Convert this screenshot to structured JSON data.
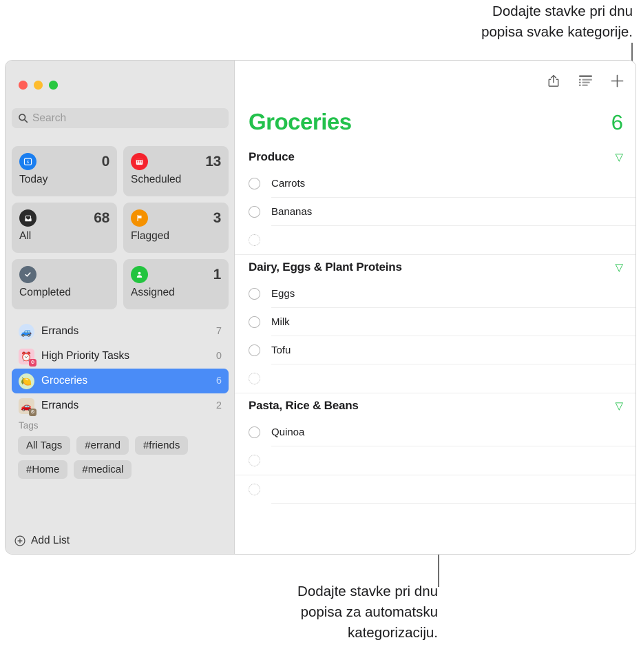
{
  "callouts": {
    "top": "Dodajte stavke pri dnu\npopisa svake kategorije.",
    "bottom": "Dodajte stavke pri dnu\npopisa za automatsku\nkategorizaciju."
  },
  "window": {
    "traffic_lights": [
      "close",
      "minimize",
      "zoom"
    ]
  },
  "sidebar": {
    "search": {
      "placeholder": "Search",
      "value": ""
    },
    "smart_lists": [
      {
        "label": "Today",
        "count": "0",
        "icon": "calendar-day-icon",
        "color": "#1a7ef0"
      },
      {
        "label": "Scheduled",
        "count": "13",
        "icon": "calendar-icon",
        "color": "#f5222d"
      },
      {
        "label": "All",
        "count": "68",
        "icon": "inbox-icon",
        "color": "#2b2b2b"
      },
      {
        "label": "Flagged",
        "count": "3",
        "icon": "flag-icon",
        "color": "#f59100"
      },
      {
        "label": "Completed",
        "count": "",
        "icon": "check-circle-icon",
        "color": "#5c6b7a"
      },
      {
        "label": "Assigned",
        "count": "1",
        "icon": "person-icon",
        "color": "#22c43f"
      }
    ],
    "lists": [
      {
        "name": "Errands",
        "count": "7",
        "glyph": "🚙",
        "bg": "#cfe2fb",
        "shape": "circle",
        "badge": "",
        "badge_bg": ""
      },
      {
        "name": "High Priority Tasks",
        "count": "0",
        "glyph": "⏰",
        "bg": "#f9c9d6",
        "shape": "square",
        "badge": "⚙",
        "badge_bg": "#e8466b"
      },
      {
        "name": "Groceries",
        "count": "6",
        "glyph": "🍋",
        "bg": "#d8edc8",
        "shape": "circle",
        "badge": "",
        "badge_bg": "",
        "selected": true
      },
      {
        "name": "Errands",
        "count": "2",
        "glyph": "🚗",
        "bg": "#e4d8c4",
        "shape": "square",
        "badge": "⚙",
        "badge_bg": "#8e7a5e"
      }
    ],
    "tags_header": "Tags",
    "tags": [
      "All Tags",
      "#errand",
      "#friends",
      "#Home",
      "#medical"
    ],
    "add_list_label": "Add List"
  },
  "main": {
    "toolbar": [
      {
        "name": "share-icon",
        "label": "Share"
      },
      {
        "name": "group-list-icon",
        "label": "List Options"
      },
      {
        "name": "plus-icon",
        "label": "Add Reminder"
      }
    ],
    "title": "Groceries",
    "total": "6",
    "groups": [
      {
        "title": "Produce",
        "items": [
          {
            "text": "Carrots",
            "state": "open"
          },
          {
            "text": "Bananas",
            "state": "open"
          },
          {
            "text": "",
            "state": "new"
          }
        ]
      },
      {
        "title": "Dairy, Eggs & Plant Proteins",
        "items": [
          {
            "text": "Eggs",
            "state": "open"
          },
          {
            "text": "Milk",
            "state": "open"
          },
          {
            "text": "Tofu",
            "state": "open"
          },
          {
            "text": "",
            "state": "new"
          }
        ]
      },
      {
        "title": "Pasta, Rice & Beans",
        "items": [
          {
            "text": "Quinoa",
            "state": "open"
          },
          {
            "text": "",
            "state": "new"
          }
        ]
      },
      {
        "title": "",
        "items": [
          {
            "text": "",
            "state": "new"
          }
        ]
      }
    ]
  },
  "colors": {
    "accent_green": "#23c14c",
    "selection_blue": "#4a8cf7",
    "sidebar_bg": "#e6e6e6",
    "callout_line": "#6e6e6e"
  }
}
